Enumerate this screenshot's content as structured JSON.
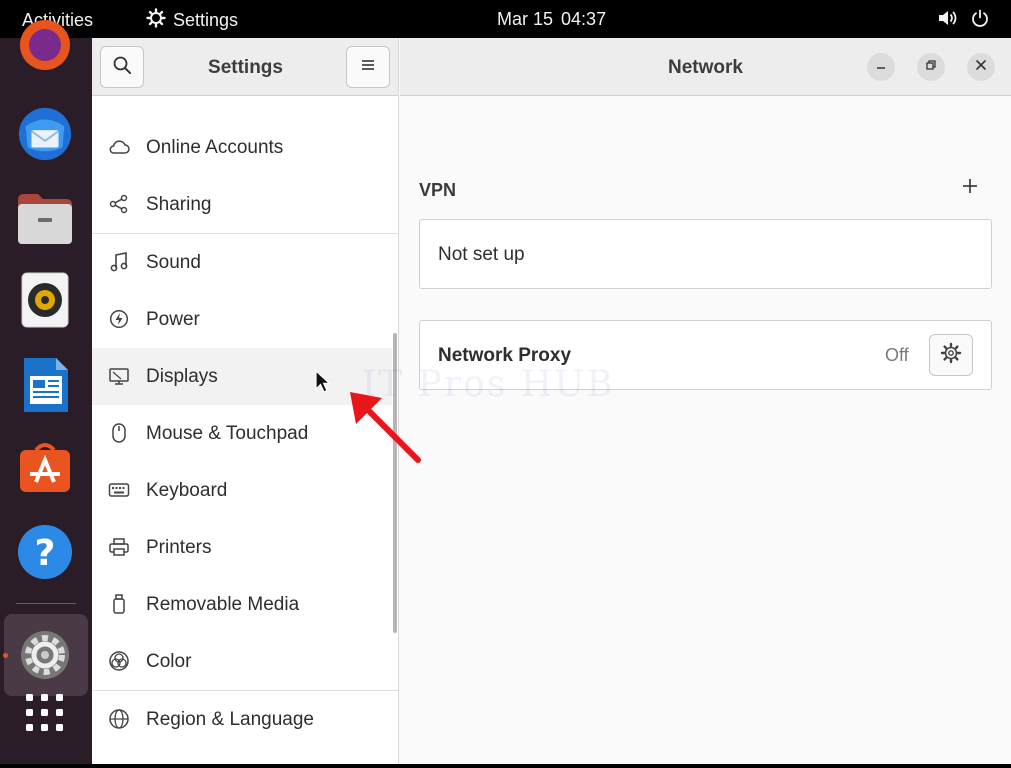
{
  "topbar": {
    "activities": "Activities",
    "app_name": "Settings",
    "date": "Mar 15",
    "time": "04:37",
    "icons": [
      "settings-gear-icon",
      "volume-icon",
      "power-icon"
    ]
  },
  "dock": {
    "items": [
      "firefox",
      "thunderbird",
      "files",
      "rhythmbox",
      "libreoffice-writer",
      "app-center",
      "help",
      "settings",
      "show-apps"
    ],
    "active": "settings"
  },
  "sidebar": {
    "title": "Settings",
    "items": [
      {
        "label": "Online Accounts",
        "icon": "cloud-icon"
      },
      {
        "label": "Sharing",
        "icon": "share-icon"
      },
      {
        "label": "Sound",
        "icon": "music-note-icon"
      },
      {
        "label": "Power",
        "icon": "power-bolt-icon"
      },
      {
        "label": "Displays",
        "icon": "display-icon"
      },
      {
        "label": "Mouse & Touchpad",
        "icon": "mouse-icon"
      },
      {
        "label": "Keyboard",
        "icon": "keyboard-icon"
      },
      {
        "label": "Printers",
        "icon": "printer-icon"
      },
      {
        "label": "Removable Media",
        "icon": "removable-media-icon"
      },
      {
        "label": "Color",
        "icon": "color-icon"
      },
      {
        "label": "Region & Language",
        "icon": "globe-icon"
      }
    ],
    "selected": "Displays"
  },
  "content": {
    "title": "Network",
    "vpn": {
      "heading": "VPN",
      "status": "Not set up"
    },
    "proxy": {
      "label": "Network Proxy",
      "state": "Off"
    }
  },
  "watermark": "IT Pros HUB",
  "colors": {
    "accent": "#e95420",
    "annotation_arrow": "#e8151b",
    "dock_bg": "#2b1d27",
    "header_bg": "#ededed"
  }
}
